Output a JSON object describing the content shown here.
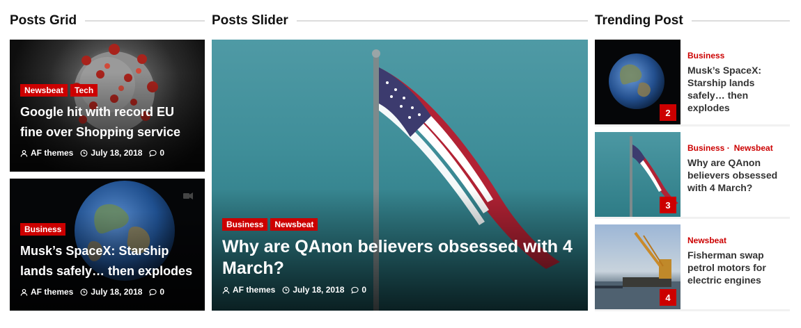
{
  "sections": {
    "grid": "Posts Grid",
    "slider": "Posts Slider",
    "trending": "Trending Post"
  },
  "grid_posts": [
    {
      "tags": [
        "Newsbeat",
        "Tech"
      ],
      "title": "Google hit with record EU fine over Shopping service",
      "author": "AF themes",
      "date": "July 18, 2018",
      "comments": "0",
      "image_icon": "coronavirus-image"
    },
    {
      "tags": [
        "Business"
      ],
      "title": "Musk’s SpaceX: Starship lands safely… then explodes",
      "author": "AF themes",
      "date": "July 18, 2018",
      "comments": "0",
      "image_icon": "earth-image",
      "format_icon": "video-camera-icon"
    }
  ],
  "slider_post": {
    "tags": [
      "Business",
      "Newsbeat"
    ],
    "title": "Why are QAnon believers obsessed with 4 March?",
    "author": "AF themes",
    "date": "July 18, 2018",
    "comments": "0",
    "image_icon": "american-flag-image"
  },
  "trending": [
    {
      "rank": "2",
      "categories": [
        "Business"
      ],
      "title": "Musk’s SpaceX: Starship lands safely… then explodes",
      "image_icon": "earth-image"
    },
    {
      "rank": "3",
      "categories": [
        "Business ·",
        "Newsbeat"
      ],
      "title": "Why are QAnon believers obsessed with 4 March?",
      "image_icon": "american-flag-image"
    },
    {
      "rank": "4",
      "categories": [
        "Newsbeat"
      ],
      "title": "Fisherman swap petrol motors for electric engines",
      "image_icon": "fishing-boat-image"
    }
  ],
  "colors": {
    "accent": "#cc0000",
    "heading": "#111111",
    "rule": "#dcdcdc"
  }
}
